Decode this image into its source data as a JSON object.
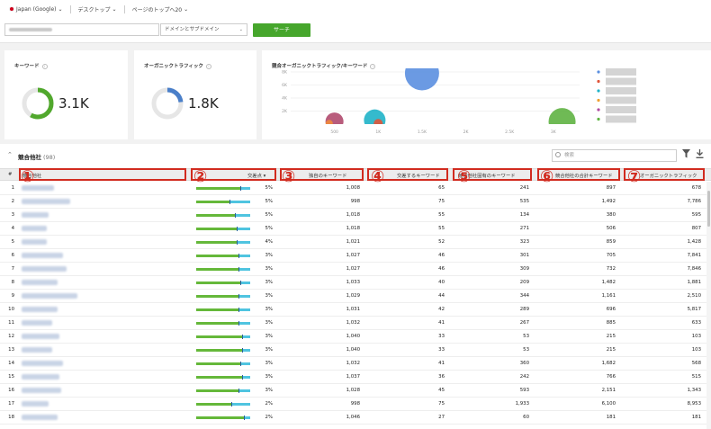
{
  "topbar": {
    "region": "Japan (Google)",
    "device": "デスクトップ",
    "back_link": "ページのトップへ20"
  },
  "search": {
    "scope": "ドメインとサブドメイン",
    "button": "サーチ"
  },
  "cards": {
    "keywords": {
      "title": "キーワード",
      "value": "3.1K"
    },
    "organic": {
      "title": "オーガニックトラフィック",
      "value": "1.8K"
    },
    "bubble": {
      "title": "競合オーガニックトラフィック/キーワード"
    }
  },
  "chart_data": {
    "type": "scatter",
    "title": "競合オーガニックトラフィック/キーワード",
    "y_ticks": [
      "8K",
      "6K",
      "4K",
      "2K"
    ],
    "x_ticks": [
      "500",
      "1K",
      "1.5K",
      "2K",
      "2.5K",
      "3K"
    ],
    "points": [
      {
        "x": 1500,
        "y": 7800,
        "r": 19,
        "color": "#5b8fe0"
      },
      {
        "x": 3100,
        "y": 400,
        "r": 15,
        "color": "#5fb342"
      },
      {
        "x": 960,
        "y": 600,
        "r": 12,
        "color": "#1fb3c8"
      },
      {
        "x": 500,
        "y": 400,
        "r": 10,
        "color": "#b04a6e"
      },
      {
        "x": 440,
        "y": 100,
        "r": 4,
        "color": "#f08a3c"
      },
      {
        "x": 1000,
        "y": 100,
        "r": 5,
        "color": "#e0553a"
      }
    ],
    "legend_colors": [
      "#5b8fe0",
      "#e0553a",
      "#1fb3c8",
      "#f0a030",
      "#b04aa0",
      "#5fb342"
    ]
  },
  "table": {
    "title": "競合他社",
    "count": "(98)",
    "filter_placeholder": "検索",
    "headers": {
      "num": "#",
      "competitor": "競合他社",
      "common": "交差点",
      "unique": "独自のキーワード",
      "intersect": "交差するキーワード",
      "comp_unique": "競合他社固有のキーワード",
      "comp_total": "競合他社の合計キーワード",
      "traffic": "オーガニックトラフィック"
    },
    "markers": [
      "①",
      "②",
      "③",
      "④",
      "⑤",
      "⑥",
      "⑦"
    ],
    "rows": [
      {
        "n": "1",
        "pct": "5%",
        "c3": "1,008",
        "c4": "65",
        "c5": "241",
        "c6": "897",
        "c7": "678"
      },
      {
        "n": "2",
        "pct": "5%",
        "c3": "998",
        "c4": "75",
        "c5": "535",
        "c6": "1,492",
        "c7": "7,786"
      },
      {
        "n": "3",
        "pct": "5%",
        "c3": "1,018",
        "c4": "55",
        "c5": "134",
        "c6": "380",
        "c7": "595"
      },
      {
        "n": "4",
        "pct": "5%",
        "c3": "1,018",
        "c4": "55",
        "c5": "271",
        "c6": "506",
        "c7": "807"
      },
      {
        "n": "5",
        "pct": "4%",
        "c3": "1,021",
        "c4": "52",
        "c5": "323",
        "c6": "859",
        "c7": "1,428"
      },
      {
        "n": "6",
        "pct": "3%",
        "c3": "1,027",
        "c4": "46",
        "c5": "301",
        "c6": "705",
        "c7": "7,841"
      },
      {
        "n": "7",
        "pct": "3%",
        "c3": "1,027",
        "c4": "46",
        "c5": "309",
        "c6": "732",
        "c7": "7,846"
      },
      {
        "n": "8",
        "pct": "3%",
        "c3": "1,033",
        "c4": "40",
        "c5": "209",
        "c6": "1,482",
        "c7": "1,881"
      },
      {
        "n": "9",
        "pct": "3%",
        "c3": "1,029",
        "c4": "44",
        "c5": "344",
        "c6": "1,161",
        "c7": "2,510"
      },
      {
        "n": "10",
        "pct": "3%",
        "c3": "1,031",
        "c4": "42",
        "c5": "289",
        "c6": "696",
        "c7": "5,817"
      },
      {
        "n": "11",
        "pct": "3%",
        "c3": "1,032",
        "c4": "41",
        "c5": "267",
        "c6": "885",
        "c7": "633"
      },
      {
        "n": "12",
        "pct": "3%",
        "c3": "1,040",
        "c4": "33",
        "c5": "53",
        "c6": "215",
        "c7": "103"
      },
      {
        "n": "13",
        "pct": "3%",
        "c3": "1,040",
        "c4": "33",
        "c5": "53",
        "c6": "215",
        "c7": "103"
      },
      {
        "n": "14",
        "pct": "3%",
        "c3": "1,032",
        "c4": "41",
        "c5": "360",
        "c6": "1,682",
        "c7": "568"
      },
      {
        "n": "15",
        "pct": "3%",
        "c3": "1,037",
        "c4": "36",
        "c5": "242",
        "c6": "766",
        "c7": "515"
      },
      {
        "n": "16",
        "pct": "3%",
        "c3": "1,028",
        "c4": "45",
        "c5": "593",
        "c6": "2,151",
        "c7": "1,343"
      },
      {
        "n": "17",
        "pct": "2%",
        "c3": "998",
        "c4": "75",
        "c5": "1,933",
        "c6": "6,100",
        "c7": "8,953"
      },
      {
        "n": "18",
        "pct": "2%",
        "c3": "1,046",
        "c4": "27",
        "c5": "60",
        "c6": "181",
        "c7": "181"
      }
    ]
  }
}
